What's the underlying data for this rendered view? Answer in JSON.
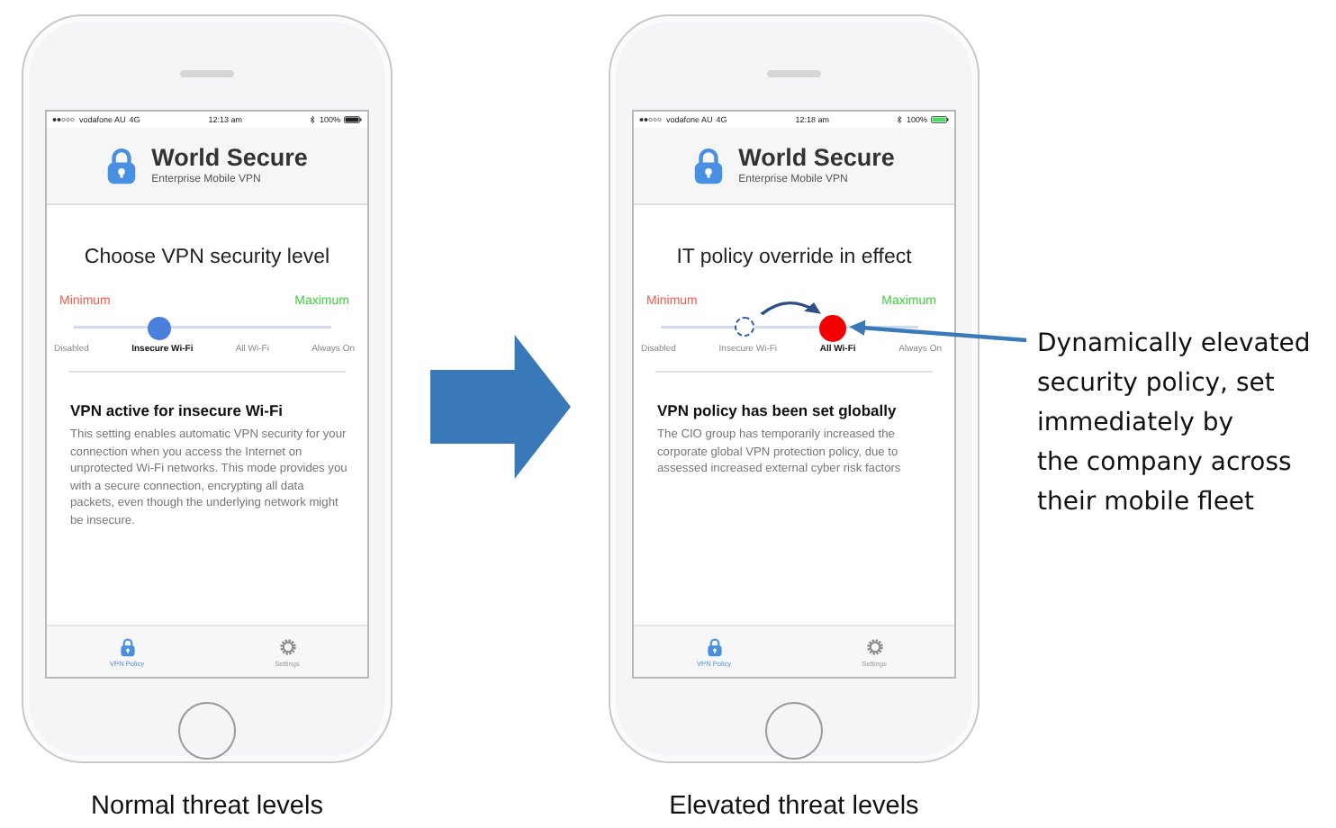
{
  "phones": [
    {
      "status_bar": {
        "carrier": "vodafone AU",
        "network": "4G",
        "time": "12:13 am",
        "battery": "100%",
        "charging": false
      },
      "app_header": {
        "title": "World Secure",
        "subtitle": "Enterprise Mobile VPN"
      },
      "heading": "Choose VPN security level",
      "slider": {
        "min_label": "Minimum",
        "max_label": "Maximum",
        "level": 0.33,
        "override": false,
        "stops": [
          {
            "label": "Disabled",
            "selected": false
          },
          {
            "label": "Insecure Wi-Fi",
            "selected": true
          },
          {
            "label": "All Wi-Fi",
            "selected": false
          },
          {
            "label": "Always On",
            "selected": false
          }
        ]
      },
      "info": {
        "title": "VPN active for insecure Wi-Fi",
        "body": "This setting enables automatic VPN security for your connection when you access the Internet on unprotected Wi-Fi networks. This mode provides you with a secure connection, encrypting all data packets, even though the underlying network might be insecure."
      },
      "tab_bar": [
        {
          "label": "VPN Policy",
          "selected": true
        },
        {
          "label": "Settings",
          "selected": false
        }
      ],
      "caption": "Normal threat levels"
    },
    {
      "status_bar": {
        "carrier": "vodafone AU",
        "network": "4G",
        "time": "12:18 am",
        "battery": "100%",
        "charging": true
      },
      "app_header": {
        "title": "World Secure",
        "subtitle": "Enterprise Mobile VPN"
      },
      "heading": "IT policy override in effect",
      "slider": {
        "min_label": "Minimum",
        "max_label": "Maximum",
        "level": 0.67,
        "override": true,
        "stops": [
          {
            "label": "Disabled",
            "selected": false,
            "previous": false
          },
          {
            "label": "Insecure Wi-Fi",
            "selected": false,
            "previous": true
          },
          {
            "label": "All Wi-Fi",
            "selected": true,
            "previous": false
          },
          {
            "label": "Always On",
            "selected": false,
            "previous": false
          }
        ]
      },
      "info": {
        "title": "VPN policy has been set globally",
        "body": "The CIO group has temporarily increased the corporate global VPN protection policy, due to assessed increased external cyber risk factors"
      },
      "tab_bar": [
        {
          "label": "VPN Policy",
          "selected": true
        },
        {
          "label": "Settings",
          "selected": false
        }
      ],
      "caption": "Elevated threat levels"
    }
  ],
  "annotation": {
    "text": "Dynamically elevated\nsecurity policy, set\nimmediately by\nthe company across\ntheir mobile fleet"
  }
}
